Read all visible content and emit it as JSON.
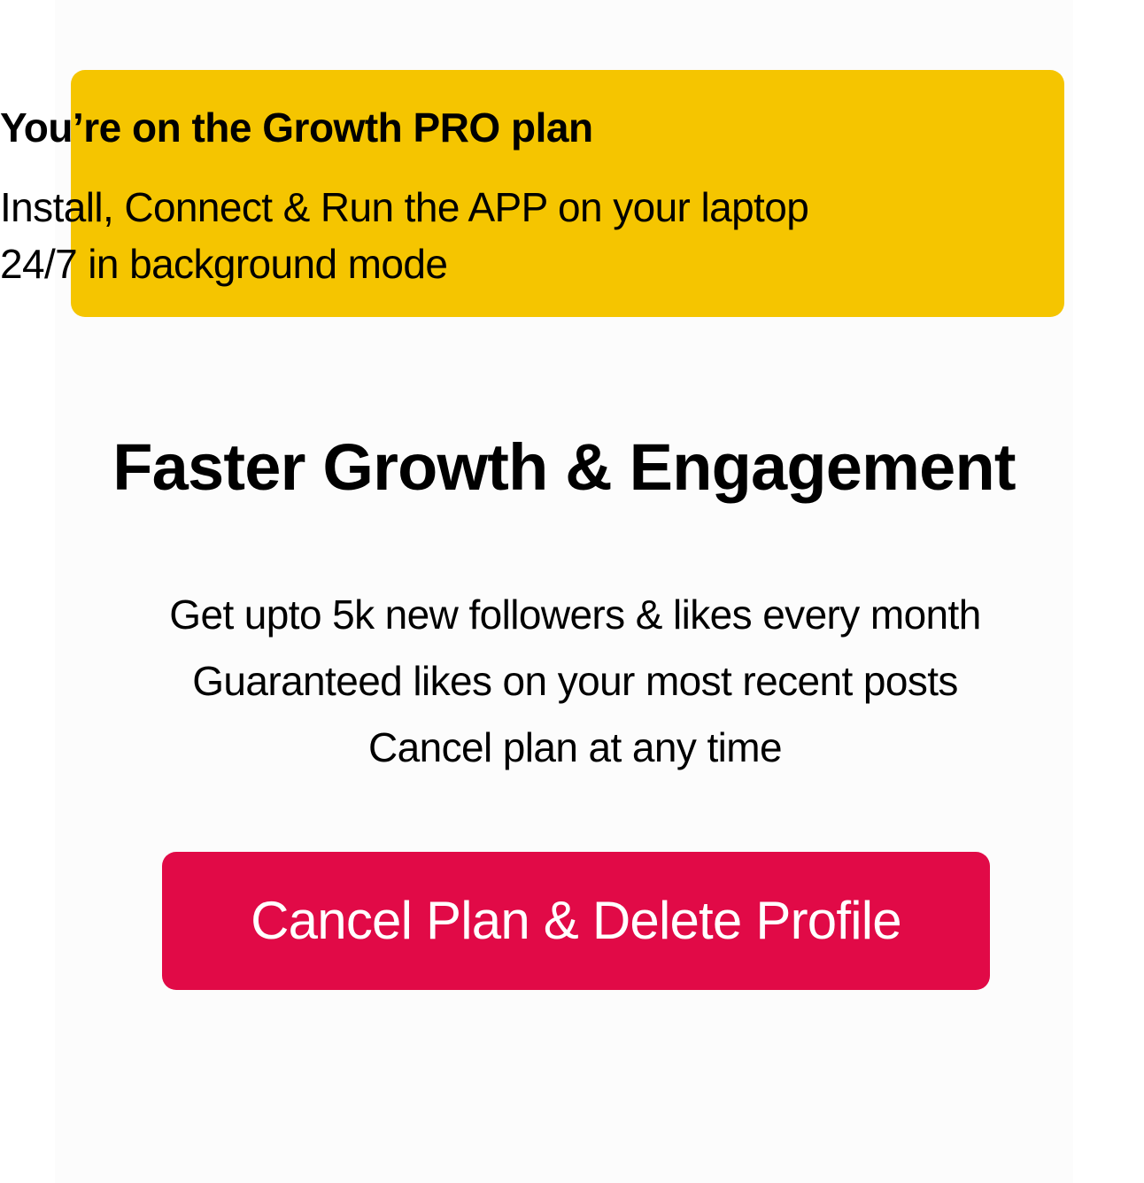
{
  "banner": {
    "title": "You’re on the Growth PRO plan",
    "line1": "Install, Connect & Run the APP on your laptop",
    "line2": "24/7 in background mode",
    "background_color": "#f5c500"
  },
  "main": {
    "headline": "Faster Growth & Engagement",
    "features": [
      "Get upto 5k new followers & likes every month",
      "Guaranteed likes on your most recent posts",
      "Cancel plan at any time"
    ]
  },
  "actions": {
    "cancel_label": "Cancel Plan & Delete Profile",
    "cancel_color": "#e10a47"
  }
}
